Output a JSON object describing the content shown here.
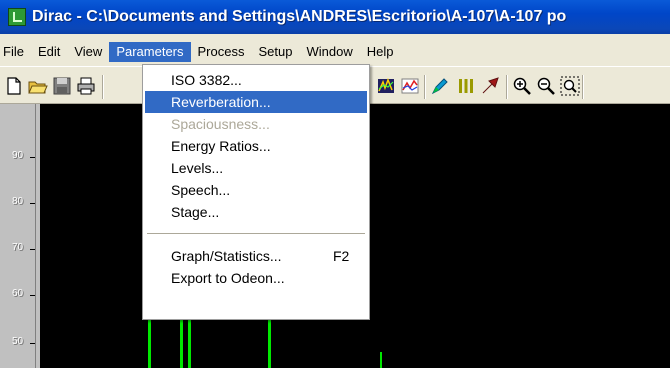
{
  "window": {
    "title": "Dirac - C:\\Documents and Settings\\ANDRES\\Escritorio\\A-107\\A-107 po"
  },
  "menubar": {
    "items": [
      "File",
      "Edit",
      "View",
      "Parameters",
      "Process",
      "Setup",
      "Window",
      "Help"
    ],
    "active": "Parameters"
  },
  "toolbar": {
    "buttons": [
      "new-icon",
      "open-folder-icon",
      "save-icon",
      "print-icon",
      "color-chart-icon",
      "line-chart-icon",
      "marker-icon",
      "bars-icon",
      "arrow-icon",
      "zoom-in-icon",
      "zoom-out-icon",
      "zoom-fit-icon"
    ]
  },
  "parameters_menu": {
    "items": [
      {
        "label": "ISO 3382...",
        "state": "normal"
      },
      {
        "label": "Reverberation...",
        "state": "selected"
      },
      {
        "label": "Spaciousness...",
        "state": "disabled"
      },
      {
        "label": "Energy Ratios...",
        "state": "normal"
      },
      {
        "label": "Levels...",
        "state": "normal"
      },
      {
        "label": "Speech...",
        "state": "normal"
      },
      {
        "label": "Stage...",
        "state": "normal"
      },
      {
        "label": "Graph/Statistics...",
        "shortcut": "F2",
        "state": "normal"
      },
      {
        "label": "Export to Odeon...",
        "state": "normal"
      }
    ]
  },
  "plot": {
    "y_ticks": [
      "90",
      "80",
      "70",
      "60",
      "50"
    ],
    "background": "#000000",
    "trace_color": "#00e800"
  }
}
